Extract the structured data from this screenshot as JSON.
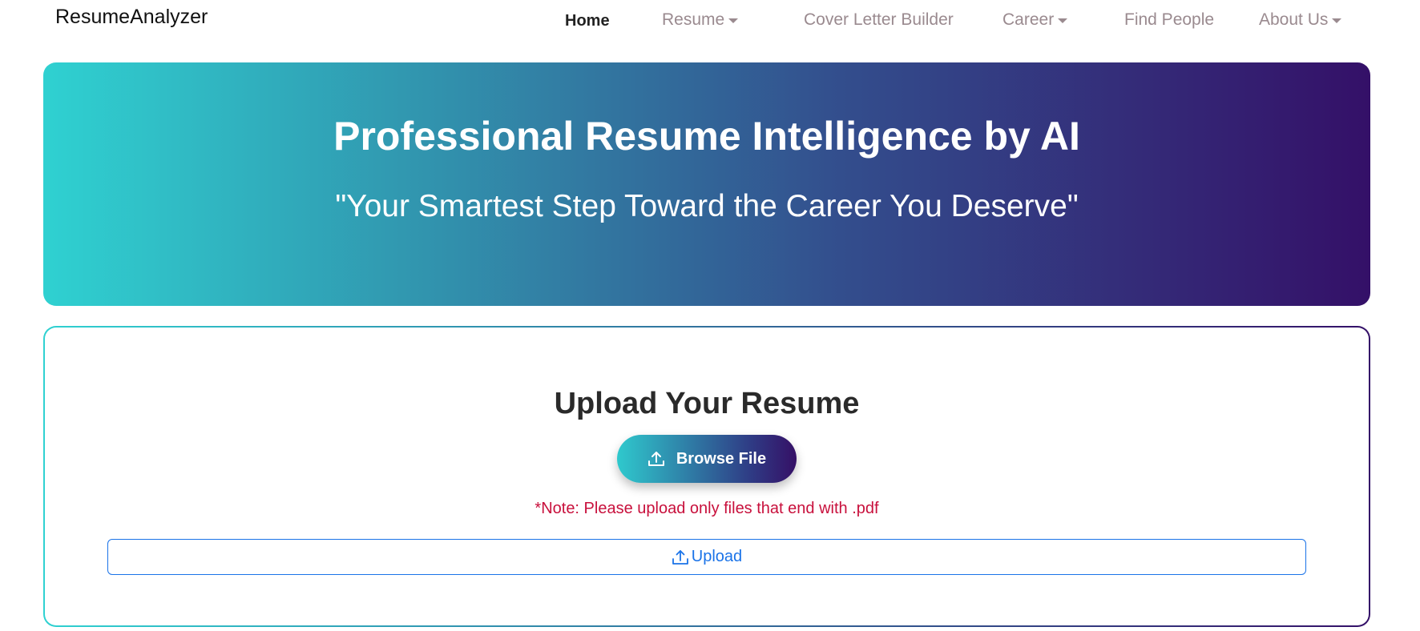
{
  "navbar": {
    "brand": "ResumeAnalyzer",
    "items": [
      {
        "label": "Home",
        "active": true,
        "dropdown": false
      },
      {
        "label": "Resume",
        "active": false,
        "dropdown": true
      },
      {
        "label": "Cover Letter Builder",
        "active": false,
        "dropdown": false
      },
      {
        "label": "Career",
        "active": false,
        "dropdown": true
      },
      {
        "label": "Find People",
        "active": false,
        "dropdown": false
      },
      {
        "label": "About Us",
        "active": false,
        "dropdown": true
      }
    ]
  },
  "hero": {
    "title": "Professional Resume Intelligence by AI",
    "subtitle": "\"Your Smartest Step Toward the Career You Deserve\""
  },
  "upload": {
    "title": "Upload Your Resume",
    "browse_label": "Browse File",
    "browse_icon": "upload-icon",
    "note": "*Note: Please upload only files that end with .pdf",
    "upload_label": "Upload",
    "upload_icon": "upload-icon"
  },
  "colors": {
    "gradient_start": "#2fd1d1",
    "gradient_end": "#341068",
    "note_color": "#c8103c",
    "link_blue": "#1a73e8",
    "nav_inactive": "#9a8a8f"
  }
}
